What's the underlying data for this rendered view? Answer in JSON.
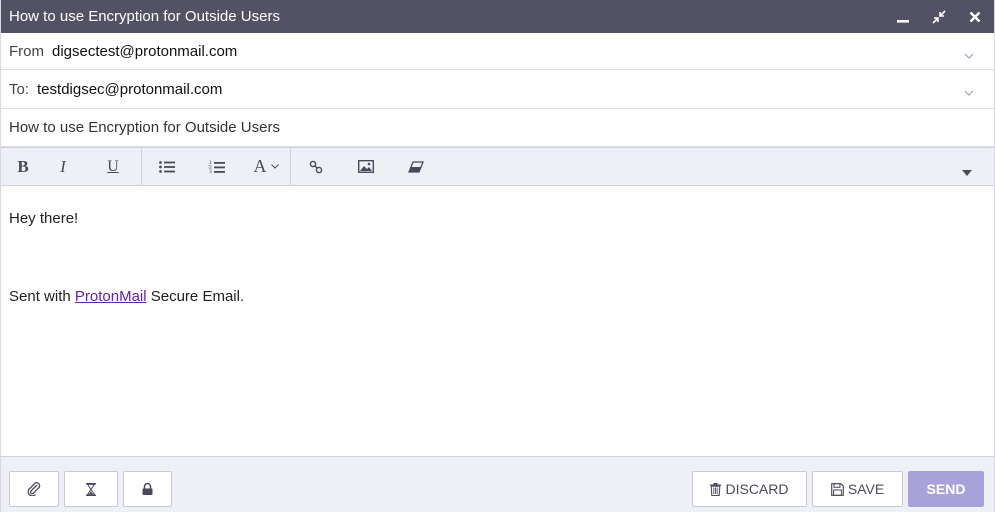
{
  "window": {
    "title": "How to use Encryption for Outside Users"
  },
  "from": {
    "label": "From",
    "value": "digsectest@protonmail.com"
  },
  "to": {
    "label": "To:",
    "value": "testdigsec@protonmail.com"
  },
  "subject": {
    "value": "How to use Encryption for Outside Users"
  },
  "toolbar": {
    "bold": "B",
    "italic": "I",
    "underline": "U",
    "font": "A"
  },
  "body": {
    "greeting": "Hey there!",
    "signature_prefix": "Sent with ",
    "signature_link": "ProtonMail",
    "signature_suffix": " Secure Email."
  },
  "footer": {
    "discard_label": "DISCARD",
    "save_label": "SAVE",
    "send_label": "SEND"
  },
  "colors": {
    "titlebar": "#535265",
    "send_button": "#a9a2da",
    "link": "#6a1fa8",
    "toolbar_bg": "#eef0f5"
  },
  "icons": [
    "minimize-icon",
    "restore-icon",
    "close-icon",
    "chevron-down-icon",
    "bullet-list-icon",
    "numbered-list-icon",
    "link-icon",
    "image-icon",
    "eraser-icon",
    "caret-down-icon",
    "paperclip-icon",
    "hourglass-icon",
    "lock-icon",
    "trash-icon",
    "floppy-disk-icon"
  ]
}
